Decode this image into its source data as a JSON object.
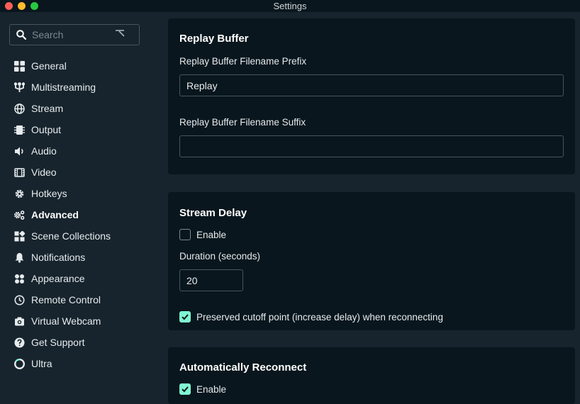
{
  "window": {
    "title": "Settings",
    "traffic_lights": {
      "close": "#fe5f57",
      "minimize": "#febc2e",
      "zoom": "#28c840"
    }
  },
  "sidebar": {
    "search_placeholder": "Search",
    "items": [
      {
        "label": "General",
        "icon": "grid-icon"
      },
      {
        "label": "Multistreaming",
        "icon": "multistream-icon"
      },
      {
        "label": "Stream",
        "icon": "globe-icon"
      },
      {
        "label": "Output",
        "icon": "chip-icon"
      },
      {
        "label": "Audio",
        "icon": "speaker-icon"
      },
      {
        "label": "Video",
        "icon": "film-icon"
      },
      {
        "label": "Hotkeys",
        "icon": "gear-icon"
      },
      {
        "label": "Advanced",
        "icon": "cogs-icon",
        "active": true
      },
      {
        "label": "Scene Collections",
        "icon": "collection-icon"
      },
      {
        "label": "Notifications",
        "icon": "bell-icon"
      },
      {
        "label": "Appearance",
        "icon": "palette-icon"
      },
      {
        "label": "Remote Control",
        "icon": "remote-icon"
      },
      {
        "label": "Virtual Webcam",
        "icon": "camera-icon"
      },
      {
        "label": "Get Support",
        "icon": "help-icon"
      },
      {
        "label": "Ultra",
        "icon": "ultra-icon"
      }
    ]
  },
  "replay_buffer": {
    "title": "Replay Buffer",
    "prefix_label": "Replay Buffer Filename Prefix",
    "prefix_value": "Replay",
    "suffix_label": "Replay Buffer Filename Suffix",
    "suffix_value": ""
  },
  "stream_delay": {
    "title": "Stream Delay",
    "enable_label": "Enable",
    "enable_checked": false,
    "duration_label": "Duration (seconds)",
    "duration_value": "20",
    "preserve_label": "Preserved cutoff point (increase delay) when reconnecting",
    "preserve_checked": true
  },
  "auto_reconnect": {
    "title": "Automatically Reconnect",
    "enable_label": "Enable",
    "enable_checked": true
  },
  "colors": {
    "accent": "#80f5d2",
    "panel": "#09161d",
    "background": "#17242d"
  }
}
